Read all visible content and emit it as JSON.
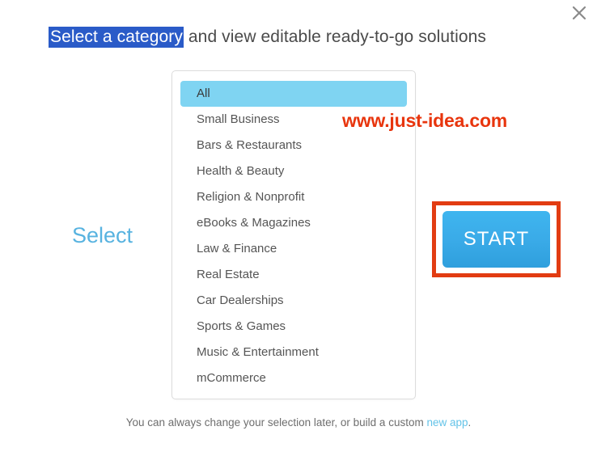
{
  "dialog": {
    "close_icon": "close-icon",
    "headline": {
      "highlighted": "Select a category",
      "rest": " and view editable ready-to-go solutions"
    },
    "select_label": "Select",
    "watermark": "www.just-idea.com",
    "start_button": "START",
    "footer": {
      "text": "You can always change your selection later, or build a custom ",
      "link": "new app",
      "suffix": "."
    }
  },
  "category_list": {
    "selected": "All",
    "items": [
      {
        "label": "All",
        "selected": true
      },
      {
        "label": "Small Business",
        "selected": false
      },
      {
        "label": "Bars & Restaurants",
        "selected": false
      },
      {
        "label": "Health & Beauty",
        "selected": false
      },
      {
        "label": "Religion & Nonprofit",
        "selected": false
      },
      {
        "label": "eBooks & Magazines",
        "selected": false
      },
      {
        "label": "Law & Finance",
        "selected": false
      },
      {
        "label": "Real Estate",
        "selected": false
      },
      {
        "label": "Car Dealerships",
        "selected": false
      },
      {
        "label": "Sports & Games",
        "selected": false
      },
      {
        "label": "Music & Entertainment",
        "selected": false
      },
      {
        "label": "mCommerce",
        "selected": false
      }
    ]
  },
  "colors": {
    "selection_highlight": "#2a5bc8",
    "list_selected_bg": "#7fd4f2",
    "accent_blue": "#58b3e0",
    "button_blue": "#3aabe8",
    "annotation_red": "#e23c12",
    "watermark_red": "#e8350d",
    "link_blue": "#63c3e8"
  }
}
